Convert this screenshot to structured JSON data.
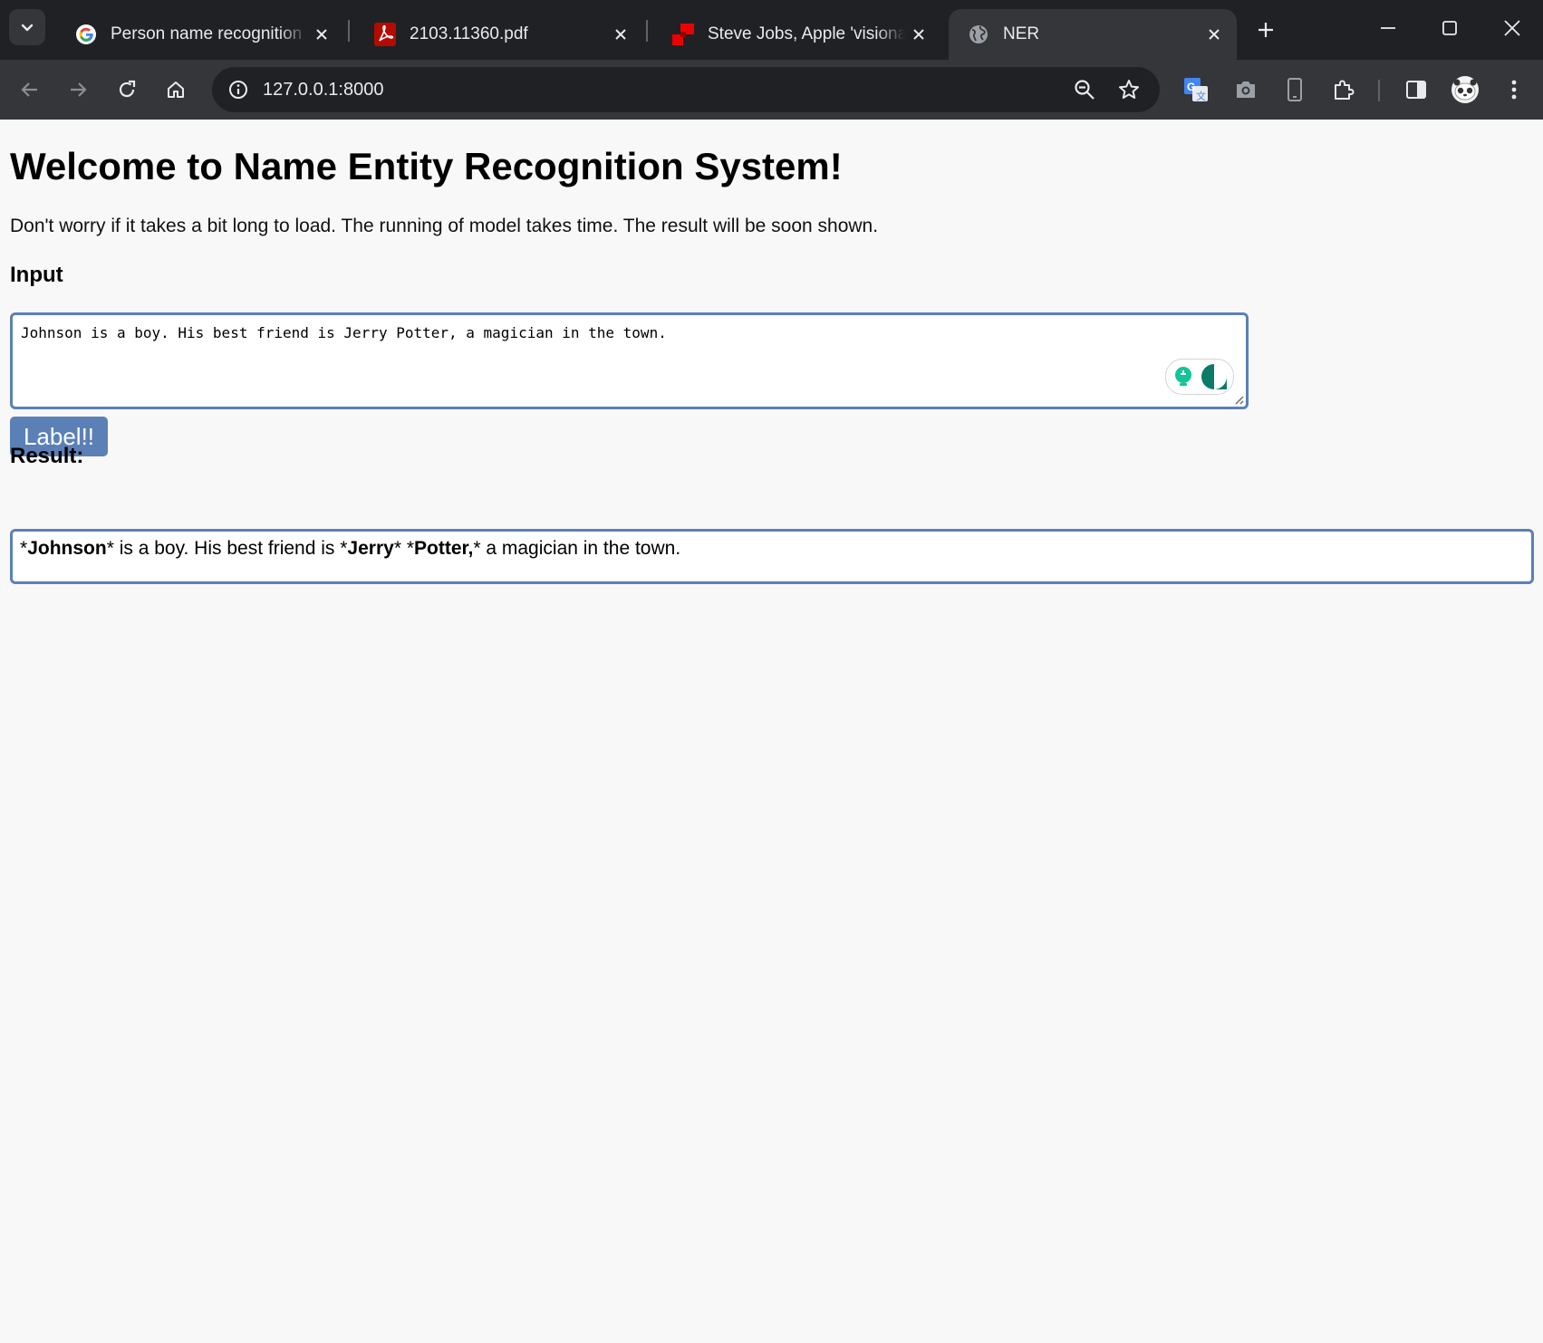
{
  "tabs": [
    {
      "title": "Person name recognition - Google",
      "favicon": "google-icon"
    },
    {
      "title": "2103.11360.pdf",
      "favicon": "pdf-icon"
    },
    {
      "title": "Steve Jobs, Apple 'visionary'",
      "favicon": "news-site-icon"
    },
    {
      "title": "NER",
      "favicon": "globe-icon",
      "active": true
    }
  ],
  "address_bar": {
    "url": "127.0.0.1:8000"
  },
  "page": {
    "heading": "Welcome to Name Entity Recognition System!",
    "note": "Don't worry if it takes a bit long to load. The running of model takes time. The result will be soon shown.",
    "input_heading": "Input",
    "input_text": "Johnson is a boy. His best friend is Jerry Potter, a magician in the town.",
    "label_button": "Label!!",
    "result_heading": "Result:",
    "result_segments": [
      {
        "text": "*",
        "bold": false
      },
      {
        "text": "Johnson",
        "bold": true
      },
      {
        "text": "* is a boy. His best friend is *",
        "bold": false
      },
      {
        "text": "Jerry",
        "bold": true
      },
      {
        "text": "* *",
        "bold": false
      },
      {
        "text": "Potter,",
        "bold": true
      },
      {
        "text": "* a magician in the town.",
        "bold": false
      }
    ]
  },
  "colors": {
    "accent": "#5b80b6",
    "page_background": "#f8f8f8",
    "chrome_dark": "#202124",
    "chrome_toolbar": "#35363a",
    "grammarly_green": "#15c39a"
  }
}
